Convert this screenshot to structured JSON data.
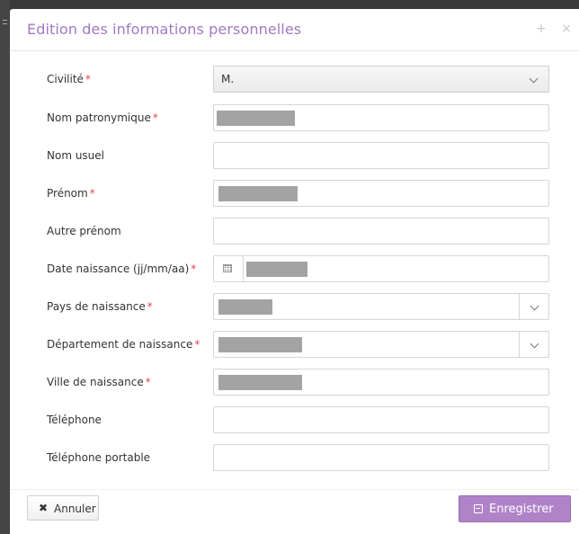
{
  "dialog": {
    "title": "Edition des informations personnelles",
    "maximize_icon": "+",
    "close_icon": "×"
  },
  "form": {
    "required_mark": "*",
    "fields": [
      {
        "label": "Civilité",
        "required": true,
        "type": "select",
        "value": "M."
      },
      {
        "label": "Nom patronymique",
        "required": true,
        "type": "text",
        "value": "[redacted]"
      },
      {
        "label": "Nom usuel",
        "required": false,
        "type": "text",
        "value": ""
      },
      {
        "label": "Prénom",
        "required": true,
        "type": "text",
        "value": "[redacted]"
      },
      {
        "label": "Autre prénom",
        "required": false,
        "type": "text",
        "value": ""
      },
      {
        "label": "Date naissance (jj/mm/aa)",
        "required": true,
        "type": "date",
        "value": "[redacted]",
        "icon": "calendar-icon"
      },
      {
        "label": "Pays de naissance",
        "required": true,
        "type": "combobox",
        "value": "[redacted]"
      },
      {
        "label": "Département de naissance",
        "required": true,
        "type": "combobox",
        "value": "[redacted]"
      },
      {
        "label": "Ville de naissance",
        "required": true,
        "type": "text",
        "value": "[redacted]"
      },
      {
        "label": "Téléphone",
        "required": false,
        "type": "text",
        "value": ""
      },
      {
        "label": "Téléphone portable",
        "required": false,
        "type": "text",
        "value": ""
      }
    ]
  },
  "footer": {
    "cancel_icon": "✖",
    "cancel_label": "Annuler",
    "save_icon": "floppy-disk-icon",
    "save_label": "Enregistrer"
  },
  "colors": {
    "title": "#a278c2",
    "save_button": "#b083c9",
    "required": "#e0474c"
  }
}
